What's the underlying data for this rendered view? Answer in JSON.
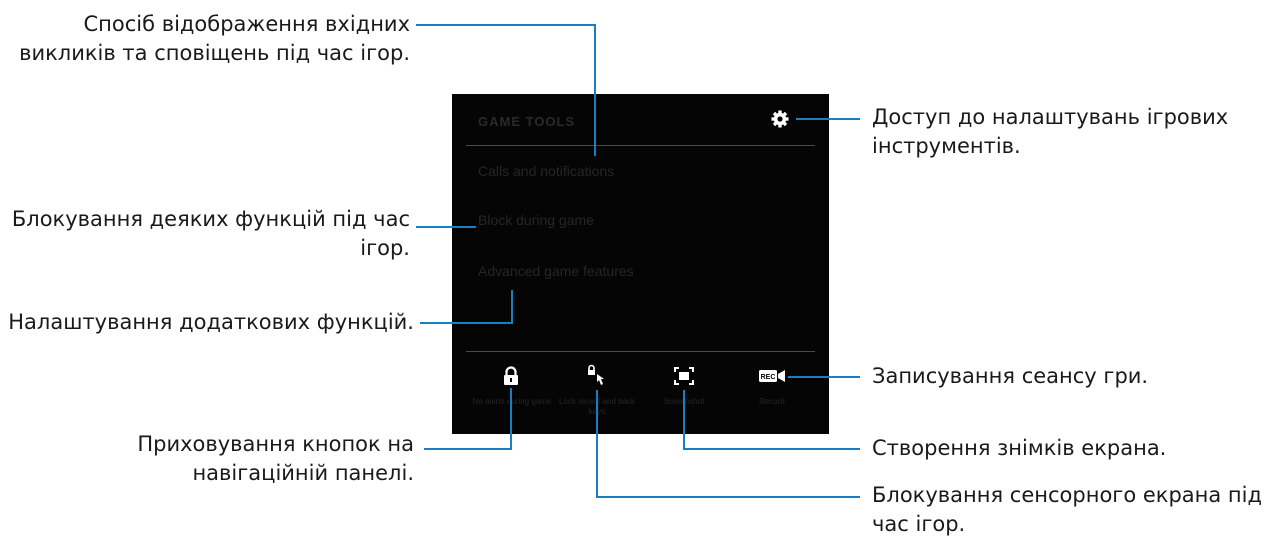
{
  "screen": {
    "title": "GAME TOOLS",
    "menu": [
      "Calls and notifications",
      "Block during game",
      "Advanced game features"
    ],
    "buttons": [
      {
        "icon": "lock-icon",
        "label": "No alerts during game"
      },
      {
        "icon": "touch-lock-icon",
        "label": "Lock recent and back keys"
      },
      {
        "icon": "screenshot-icon",
        "label": "Screenshot"
      },
      {
        "icon": "record-icon",
        "label": "Record"
      }
    ]
  },
  "callouts": {
    "calls_line1": "Спосіб відображення вхідних",
    "calls_line2": "викликів та сповіщень під час ігор.",
    "block_line1": "Блокування деяких функцій під час",
    "block_line2": "ігор.",
    "advanced": "Налаштування додаткових функцій.",
    "navbar_line1": "Приховування кнопок на",
    "navbar_line2": "навігаційній панелі.",
    "settings_line1": "Доступ до налаштувань ігрових",
    "settings_line2": "інструментів.",
    "record": "Записування сеансу гри.",
    "screenshot": "Створення знімків екрана.",
    "touchlock_line1": "Блокування сенсорного екрана під",
    "touchlock_line2": "час ігор."
  },
  "colors": {
    "leader": "#1a7fbf",
    "screen_bg": "#050505"
  }
}
